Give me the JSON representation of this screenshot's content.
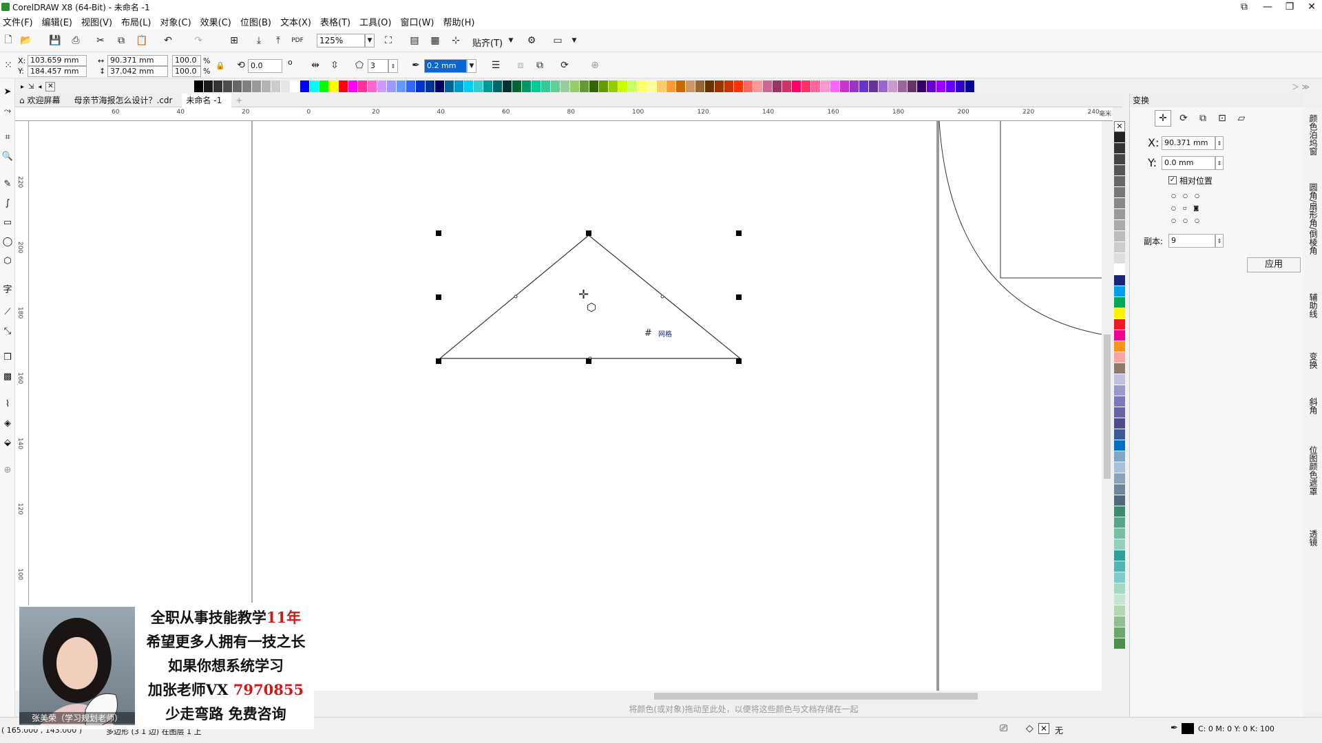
{
  "window": {
    "title": "CorelDRAW X8 (64-Bit) - 未命名 -1"
  },
  "menu": [
    "文件(F)",
    "编辑(E)",
    "视图(V)",
    "布局(L)",
    "对象(C)",
    "效果(C)",
    "位图(B)",
    "文本(X)",
    "表格(T)",
    "工具(O)",
    "窗口(W)",
    "帮助(H)"
  ],
  "toolbar": {
    "zoom": "125%",
    "snap_label": "贴齐(T)"
  },
  "property_bar": {
    "x": "103.659 mm",
    "y": "184.457 mm",
    "width": "90.371 mm",
    "height": "37.042 mm",
    "scale_w": "100.0",
    "scale_h": "100.0",
    "percent": "%",
    "rotation": "0.0",
    "degree": "o",
    "sides": "3",
    "outline_width": "0.2 mm",
    "x_label": "X:",
    "y_label": "Y:"
  },
  "tabs": [
    "欢迎屏幕",
    "母亲节海报怎么设计？.cdr",
    "未命名 -1"
  ],
  "ruler_h": [
    "60",
    "40",
    "20",
    "0",
    "20",
    "40",
    "60",
    "80",
    "100",
    "120",
    "140",
    "160",
    "180",
    "200",
    "220",
    "240",
    "毫米"
  ],
  "ruler_v": [
    "220",
    "200",
    "180",
    "160",
    "140",
    "120",
    "100"
  ],
  "canvas": {
    "snap_hint": "网格"
  },
  "docker": {
    "title": "变换",
    "x_label": "X:",
    "x_value": "90.371 mm",
    "y_label": "Y:",
    "y_value": "0.0 mm",
    "relative_label": "相对位置",
    "copies_label": "副本:",
    "copies_value": "9",
    "apply_label": "应用"
  },
  "side_tabs": [
    "颜色泊坞窗",
    "圆角/扇形角/倒棱角",
    "辅助线",
    "变换",
    "斜角",
    "位图颜色遮罩",
    "透镜"
  ],
  "doc_palette_hint": "将颜色(或对象)拖动至此处，以便将这些颜色与文档存储在一起",
  "status": {
    "coords": "( 165.000 , 143.000 )",
    "object_info": "多边形 (3 1 边) 在图层 1 上",
    "fill_label": "无",
    "outline_info": "C: 0 M: 0 Y: 0 K: 100"
  },
  "promo": {
    "line1_a": "全职从事技能教学",
    "line1_b": "11年",
    "line2": "希望更多人拥有一技之长",
    "line3": "如果你想系统学习",
    "line4_a": "加张老师VX ",
    "line4_b": "7970855",
    "line5": "少走弯路 免费咨询",
    "caption": "张美荣（学习规划老师）"
  },
  "colors": {
    "palette": [
      "#000000",
      "#1a1a1a",
      "#333333",
      "#4d4d4d",
      "#666666",
      "#808080",
      "#999999",
      "#b3b3b3",
      "#cccccc",
      "#e6e6e6",
      "#ffffff",
      "#0000ff",
      "#00ffff",
      "#00ff00",
      "#ffff00",
      "#ff0000",
      "#ff00ff",
      "#ff3399",
      "#ff66cc",
      "#cc99ff",
      "#9999ff",
      "#6699ff",
      "#3366ff",
      "#0033cc",
      "#003399",
      "#000066",
      "#006699",
      "#0099cc",
      "#00ccff",
      "#33cccc",
      "#009999",
      "#006666",
      "#003333",
      "#006633",
      "#009966",
      "#00cc99",
      "#33cc99",
      "#66cc99",
      "#99cc99",
      "#99cc66",
      "#669933",
      "#336600",
      "#669900",
      "#99cc00",
      "#ccff00",
      "#ccff66",
      "#ffff66",
      "#ffff99",
      "#ffcc66",
      "#ff9933",
      "#cc6600",
      "#cc9966",
      "#996633",
      "#663300",
      "#993300",
      "#cc3300",
      "#ff3300",
      "#ff6666",
      "#ff9999",
      "#cc6699",
      "#993366",
      "#cc3366",
      "#ff0066",
      "#ff3366",
      "#ff6699",
      "#ff99cc",
      "#ff66ff",
      "#cc33cc",
      "#9933cc",
      "#6633cc",
      "#663399",
      "#9966cc",
      "#cc99cc",
      "#996699",
      "#663366",
      "#330066",
      "#6600cc",
      "#9900ff",
      "#6600ff",
      "#3300cc",
      "#000099"
    ],
    "vpalette": [
      "#222222",
      "#333333",
      "#444444",
      "#555555",
      "#666666",
      "#777777",
      "#888888",
      "#999999",
      "#aaaaaa",
      "#bbbbbb",
      "#cccccc",
      "#dddddd",
      "#ffffff",
      "#1a237e",
      "#00a0e9",
      "#00a651",
      "#fff200",
      "#ed1c24",
      "#ec008c",
      "#f7941d",
      "#f9a3a3",
      "#8c7b6b",
      "#c0c0e0",
      "#9999cc",
      "#7a7ab8",
      "#6666a3",
      "#4d4d8a",
      "#3b5998",
      "#0070c0",
      "#7fa7c9",
      "#a6c0d9",
      "#8aa3b8",
      "#6e8699",
      "#53697a",
      "#3e8a70",
      "#5aa58a",
      "#77bfa3",
      "#94d1bb",
      "#2e9e9e",
      "#55b5b5",
      "#80cccc",
      "#a3d9c2",
      "#c2e6d1",
      "#b3d9b3",
      "#8fc08f",
      "#6ba86b",
      "#4d8f4d"
    ]
  }
}
